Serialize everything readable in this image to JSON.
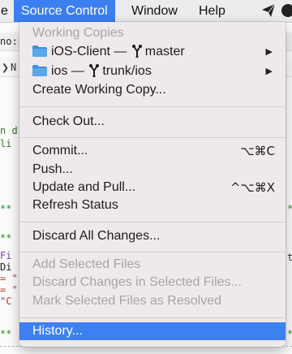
{
  "menubar": {
    "cut_label": "e",
    "source_control": "Source Control",
    "window": "Window",
    "help": "Help"
  },
  "background": {
    "frag_no": "no:",
    "frag_n": "N",
    "frag_cd": "n d",
    "frag_li": "li",
    "frag_stars1": "**",
    "frag_stars2": "**",
    "frag_fi": "Fi",
    "frag_di": "Di",
    "frag_eq1": "= \"",
    "frag_eq2": "= \"",
    "frag_c": "\"C",
    "frag_stars3": "**",
    "frag_t": "t",
    "frag_right": "*",
    "frag_right2": "*"
  },
  "menu": {
    "header_working_copies": "Working Copies",
    "wc1_name": "iOS-Client",
    "wc1_sep": " — ",
    "wc1_branch": "master",
    "wc2_name": "ios",
    "wc2_sep": " — ",
    "wc2_branch": "trunk/ios",
    "create_working_copy": "Create Working Copy...",
    "check_out": "Check Out...",
    "commit": "Commit...",
    "commit_shortcut": "⌥⌘C",
    "push": "Push...",
    "update_and_pull": "Update and Pull...",
    "update_shortcut": "^⌥⌘X",
    "refresh_status": "Refresh Status",
    "discard_all": "Discard All Changes...",
    "add_selected": "Add Selected Files",
    "discard_selected": "Discard Changes in Selected Files...",
    "mark_resolved": "Mark Selected Files as Resolved",
    "history": "History...",
    "submenu_arrow": "▶"
  },
  "colors": {
    "menubar_bg": "#ececec",
    "highlight": "#3d80f2",
    "disabled_text": "#a7a4a6",
    "folder_blue": "#3d8fd8"
  }
}
